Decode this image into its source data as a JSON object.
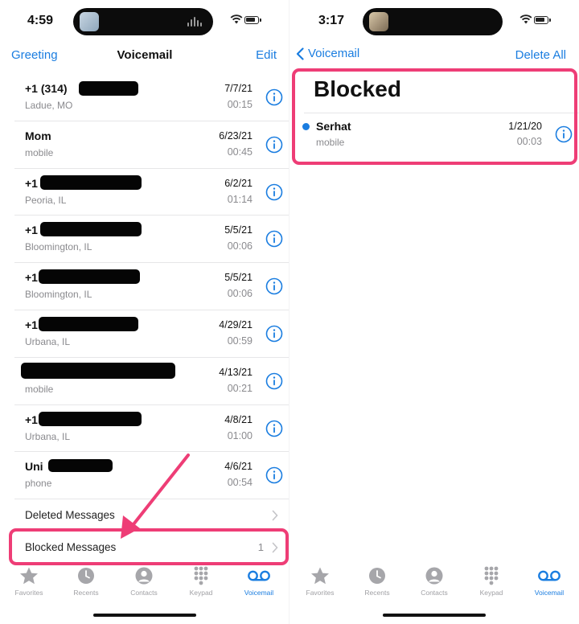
{
  "colors": {
    "accent": "#1a7de0",
    "highlight": "#ee3d76",
    "text": "#111111",
    "secondary": "#8a8a8e"
  },
  "left_screen": {
    "status": {
      "time": "4:59"
    },
    "nav": {
      "left_button": "Greeting",
      "title": "Voicemail",
      "right_button": "Edit"
    },
    "voicemails": [
      {
        "name": "+1 (314)",
        "sub": "Ladue, MO",
        "date": "7/7/21",
        "duration": "00:15"
      },
      {
        "name": "Mom",
        "sub": "mobile",
        "date": "6/23/21",
        "duration": "00:45"
      },
      {
        "name": "+1",
        "sub": "Peoria, IL",
        "date": "6/2/21",
        "duration": "01:14"
      },
      {
        "name": "+1",
        "sub": "Bloomington, IL",
        "date": "5/5/21",
        "duration": "00:06"
      },
      {
        "name": "+1",
        "sub": "Bloomington, IL",
        "date": "5/5/21",
        "duration": "00:06"
      },
      {
        "name": "+1",
        "sub": "Urbana, IL",
        "date": "4/29/21",
        "duration": "00:59"
      },
      {
        "name": "",
        "sub": "mobile",
        "date": "4/13/21",
        "duration": "00:21"
      },
      {
        "name": "+1",
        "sub": "Urbana, IL",
        "date": "4/8/21",
        "duration": "01:00"
      },
      {
        "name": "Uni",
        "sub": "phone",
        "date": "4/6/21",
        "duration": "00:54"
      }
    ],
    "deleted_messages": {
      "label": "Deleted Messages"
    },
    "blocked_messages": {
      "label": "Blocked Messages",
      "count": "1"
    }
  },
  "right_screen": {
    "status": {
      "time": "3:17"
    },
    "nav": {
      "back_label": "Voicemail",
      "right_button": "Delete All"
    },
    "title": "Blocked",
    "entry": {
      "name": "Serhat",
      "sub": "mobile",
      "date": "1/21/20",
      "duration": "00:03"
    }
  },
  "tab_bar": {
    "tabs": [
      {
        "label": "Favorites",
        "icon": "star-icon"
      },
      {
        "label": "Recents",
        "icon": "clock-icon"
      },
      {
        "label": "Contacts",
        "icon": "person-icon"
      },
      {
        "label": "Keypad",
        "icon": "keypad-icon"
      },
      {
        "label": "Voicemail",
        "icon": "voicemail-icon",
        "active": true
      }
    ]
  }
}
